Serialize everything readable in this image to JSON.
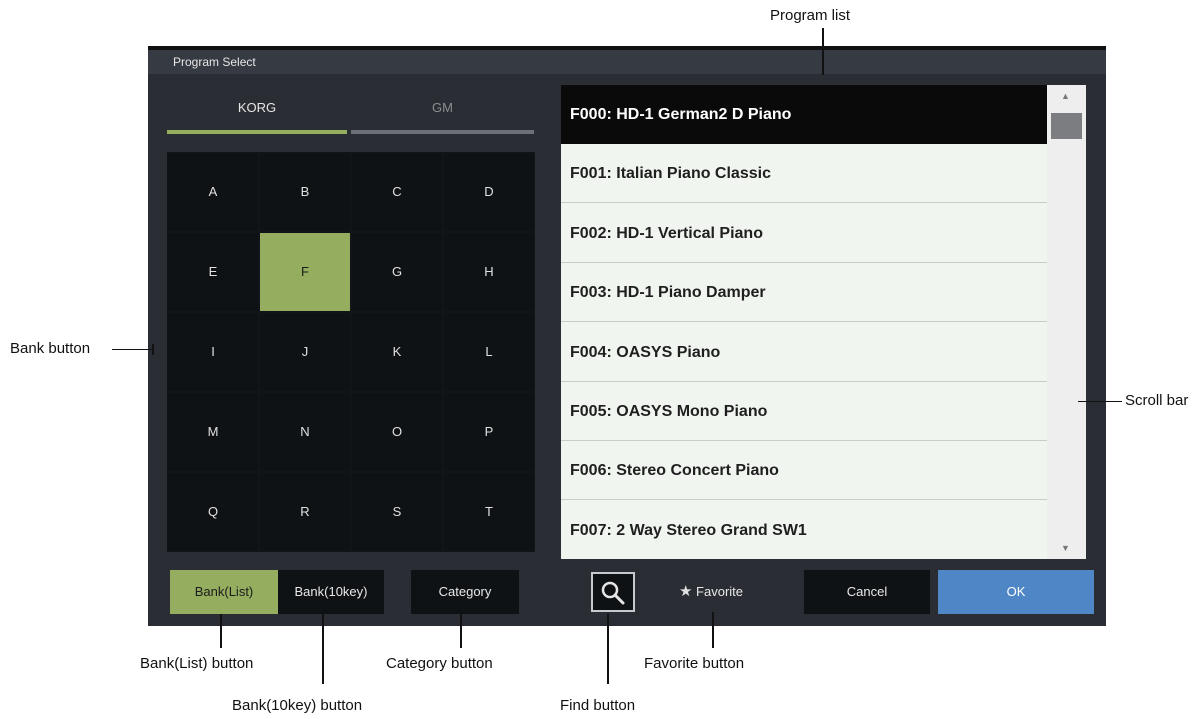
{
  "callouts": {
    "program_list": "Program list",
    "bank_button": "Bank button",
    "scroll_bar": "Scroll bar",
    "bank_list_button": "Bank(List) button",
    "bank_10key_button": "Bank(10key) button",
    "category_button": "Category button",
    "find_button": "Find button",
    "favorite_button": "Favorite button"
  },
  "dialog": {
    "title": "Program Select",
    "tabs": [
      {
        "label": "KORG",
        "active": true
      },
      {
        "label": "GM",
        "active": false
      }
    ],
    "banks": [
      "A",
      "B",
      "C",
      "D",
      "E",
      "F",
      "G",
      "H",
      "I",
      "J",
      "K",
      "L",
      "M",
      "N",
      "O",
      "P",
      "Q",
      "R",
      "S",
      "T"
    ],
    "selected_bank": "F",
    "programs": [
      "F000: HD-1 German2 D Piano",
      "F001: Italian Piano Classic",
      "F002: HD-1 Vertical Piano",
      "F003: HD-1 Piano Damper",
      "F004: OASYS Piano",
      "F005: OASYS Mono Piano",
      "F006: Stereo Concert Piano",
      "F007: 2 Way Stereo Grand SW1"
    ],
    "selected_program_index": 0,
    "scroll_position": 0.0,
    "buttons": {
      "bank_list": "Bank(List)",
      "bank_10key": "Bank(10key)",
      "category": "Category",
      "favorite": "Favorite",
      "cancel": "Cancel",
      "ok": "OK"
    },
    "icons": {
      "find": "magnifier-icon",
      "favorite": "star-icon",
      "scroll_up": "triangle-up-icon",
      "scroll_down": "triangle-down-icon"
    },
    "colors": {
      "accent_green": "#94ad5f",
      "ok_blue": "#4f86c6",
      "dialog_bg": "#2a2d33"
    }
  }
}
